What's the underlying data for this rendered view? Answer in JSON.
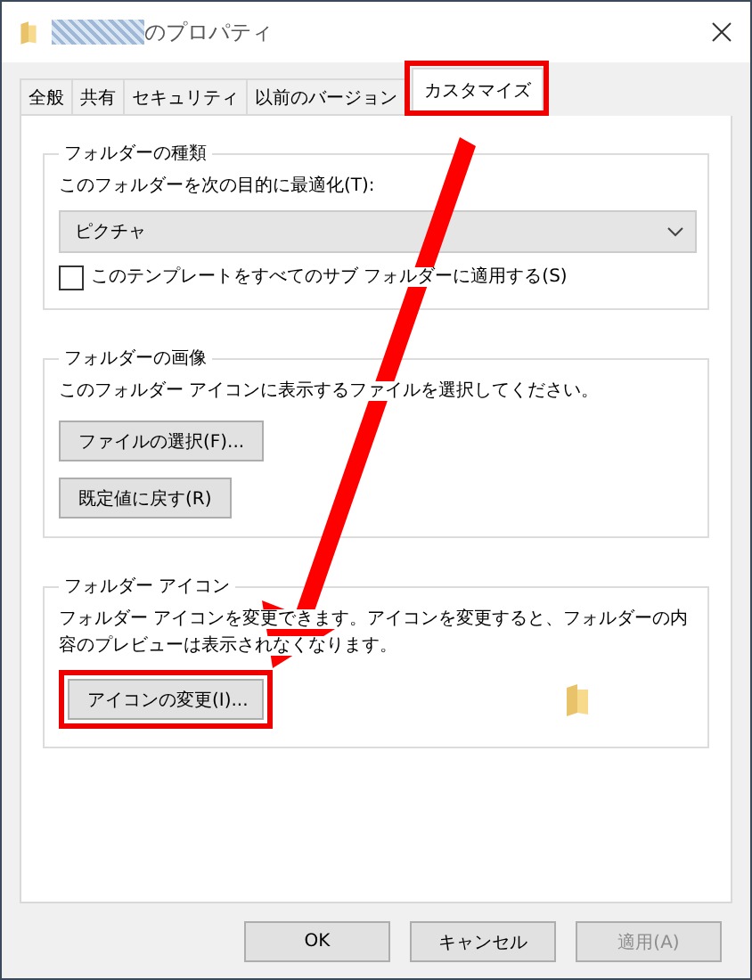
{
  "window": {
    "title": "のプロパティ"
  },
  "tabs": [
    {
      "label": "全般",
      "selected": false
    },
    {
      "label": "共有",
      "selected": false
    },
    {
      "label": "セキュリティ",
      "selected": false
    },
    {
      "label": "以前のバージョン",
      "selected": false
    },
    {
      "label": "カスタマイズ",
      "selected": true
    }
  ],
  "folder_type": {
    "title": "フォルダーの種類",
    "label": "このフォルダーを次の目的に最適化(T):",
    "dropdown": "ピクチャ",
    "checkbox": {
      "label": "このテンプレートをすべてのサブ フォルダーに適用する(S)",
      "checked": false
    }
  },
  "folder_picture": {
    "title": "フォルダーの画像",
    "text": "このフォルダー アイコンに表示するファイルを選択してください。",
    "buttons": [
      "ファイルの選択(F)...",
      "既定値に戻す(R)"
    ]
  },
  "folder_icon": {
    "title": "フォルダー アイコン",
    "text": "フォルダー アイコンを変更できます。アイコンを変更すると、フォルダーの内容のプレビューは表示されなくなります。",
    "button": "アイコンの変更(I)..."
  },
  "buttons": [
    {
      "label": "OK",
      "disabled": false
    },
    {
      "label": "キャンセル",
      "disabled": false
    },
    {
      "label": "適用(A)",
      "disabled": true
    }
  ]
}
